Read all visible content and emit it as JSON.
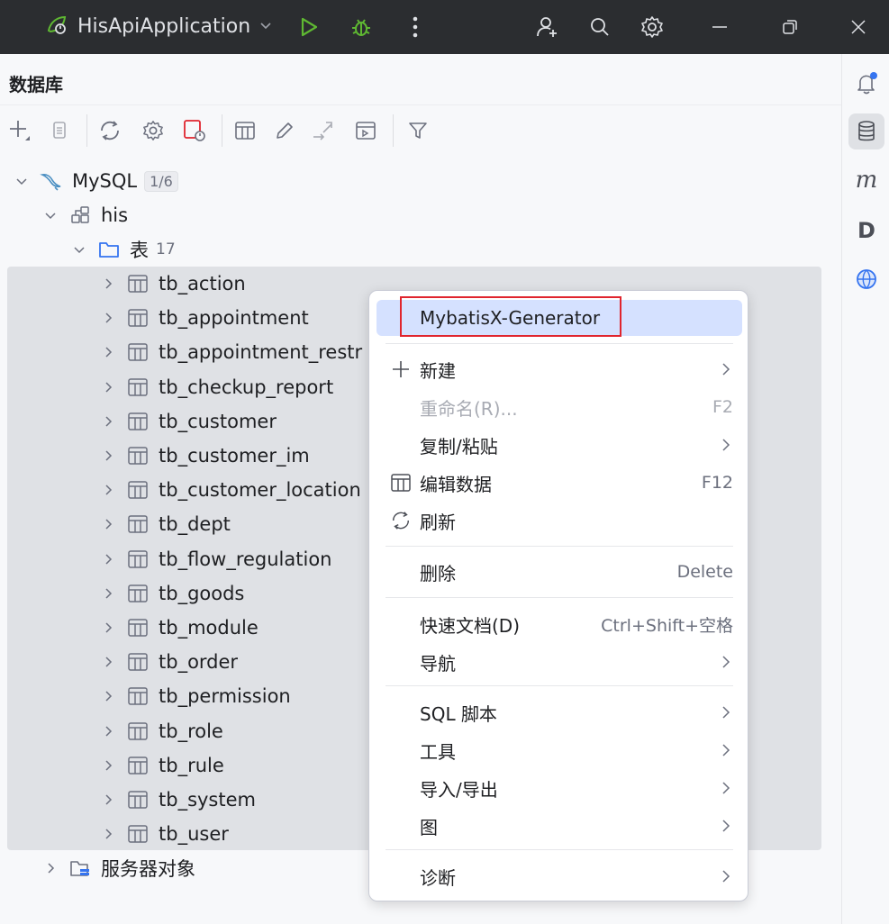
{
  "titlebar": {
    "project_name": "HisApiApplication",
    "icons": [
      "spring-boot-icon",
      "chevron-down-icon",
      "run-icon",
      "debug-icon",
      "more-vertical-icon",
      "add-user-icon",
      "search-icon",
      "gear-icon",
      "minimize-icon",
      "restore-icon",
      "close-icon"
    ],
    "accent_run": "#57965c"
  },
  "panel": {
    "title": "数据库"
  },
  "toolbar": {
    "icons": [
      "add-icon",
      "copy-icon",
      "refresh-icon",
      "settings-icon",
      "console-icon",
      "table-icon",
      "edit-icon",
      "jump-icon",
      "query-console-icon",
      "filter-icon"
    ]
  },
  "tree": {
    "root": {
      "label": "MySQL",
      "badge": "1/6"
    },
    "schema": {
      "label": "his"
    },
    "tables_folder": {
      "label": "表",
      "count": "17"
    },
    "tables": [
      "tb_action",
      "tb_appointment",
      "tb_appointment_restr",
      "tb_checkup_report",
      "tb_customer",
      "tb_customer_im",
      "tb_customer_location",
      "tb_dept",
      "tb_flow_regulation",
      "tb_goods",
      "tb_module",
      "tb_order",
      "tb_permission",
      "tb_role",
      "tb_rule",
      "tb_system",
      "tb_user"
    ],
    "server_objects": {
      "label": "服务器对象"
    }
  },
  "context_menu": {
    "generator": {
      "label": "MybatisX-Generator"
    },
    "new": {
      "label": "新建"
    },
    "rename": {
      "label": "重命名(R)...",
      "shortcut": "F2"
    },
    "copy_paste": {
      "label": "复制/粘贴"
    },
    "edit_data": {
      "label": "编辑数据",
      "shortcut": "F12"
    },
    "refresh": {
      "label": "刷新"
    },
    "delete": {
      "label": "删除",
      "shortcut": "Delete"
    },
    "quick_doc": {
      "label": "快速文档(D)",
      "shortcut": "Ctrl+Shift+空格"
    },
    "navigate": {
      "label": "导航"
    },
    "sql_script": {
      "label": "SQL 脚本"
    },
    "tools": {
      "label": "工具"
    },
    "import_export": {
      "label": "导入/导出"
    },
    "diagram": {
      "label": "图"
    },
    "diagnostics": {
      "label": "诊断"
    }
  },
  "right_strip": {
    "icons": [
      "notifications-icon",
      "database-icon",
      "mybatis-icon",
      "d-plugin-icon",
      "web-icon"
    ],
    "m_label": "m",
    "d_label": "D"
  },
  "colors": {
    "highlight": "#d5e1ff",
    "selection": "#dfe1e5",
    "red_box": "#e0252e",
    "notification_dot": "#3574f0"
  }
}
